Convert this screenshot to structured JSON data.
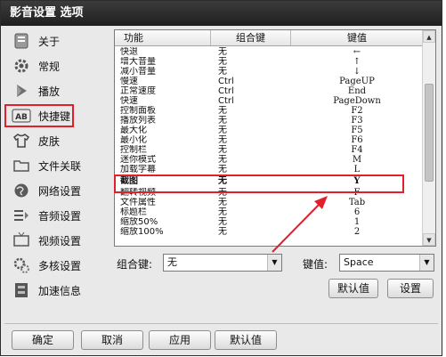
{
  "window": {
    "title": "影音设置 选项"
  },
  "sidebar": {
    "items": [
      {
        "label": "关于",
        "icon": "about-icon"
      },
      {
        "label": "常规",
        "icon": "gear-icon"
      },
      {
        "label": "播放",
        "icon": "play-icon"
      },
      {
        "label": "快捷键",
        "icon": "keyboard-ab-icon",
        "active": true
      },
      {
        "label": "皮肤",
        "icon": "shirt-icon"
      },
      {
        "label": "文件关联",
        "icon": "folder-icon"
      },
      {
        "label": "网络设置",
        "icon": "globe-icon"
      },
      {
        "label": "音频设置",
        "icon": "audio-icon"
      },
      {
        "label": "视频设置",
        "icon": "tv-icon"
      },
      {
        "label": "多核设置",
        "icon": "multicore-icon"
      },
      {
        "label": "加速信息",
        "icon": "accelerate-icon"
      }
    ]
  },
  "table": {
    "headers": [
      "功能",
      "组合键",
      "键值"
    ],
    "rows": [
      [
        "快退",
        "无",
        "←"
      ],
      [
        "增大音量",
        "无",
        "↑"
      ],
      [
        "减小音量",
        "无",
        "↓"
      ],
      [
        "慢速",
        "Ctrl",
        "PageUP"
      ],
      [
        "正常速度",
        "Ctrl",
        "End"
      ],
      [
        "快速",
        "Ctrl",
        "PageDown"
      ],
      [
        "控制面板",
        "无",
        "F2"
      ],
      [
        "播放列表",
        "无",
        "F3"
      ],
      [
        "最大化",
        "无",
        "F5"
      ],
      [
        "最小化",
        "无",
        "F6"
      ],
      [
        "控制栏",
        "无",
        "F4"
      ],
      [
        "迷你模式",
        "无",
        "M"
      ],
      [
        "加载字幕",
        "无",
        "L"
      ],
      [
        "截图",
        "无",
        "Y"
      ],
      [
        "翻转视频",
        "无",
        "F"
      ],
      [
        "文件属性",
        "无",
        "Tab"
      ],
      [
        "标题栏",
        "无",
        "6"
      ],
      [
        "缩放50%",
        "无",
        "1"
      ],
      [
        "缩放100%",
        "无",
        "2"
      ]
    ],
    "selected_row": 13
  },
  "controls": {
    "modifier_label": "组合键:",
    "modifier_value": "无",
    "key_label": "键值:",
    "key_value": "Space",
    "default_button": "默认值",
    "set_button": "设置"
  },
  "footer": {
    "ok": "确定",
    "cancel": "取消",
    "apply": "应用",
    "default": "默认值"
  },
  "colors": {
    "annotation": "#e0212c",
    "titlebar": "#2a2a2a"
  }
}
